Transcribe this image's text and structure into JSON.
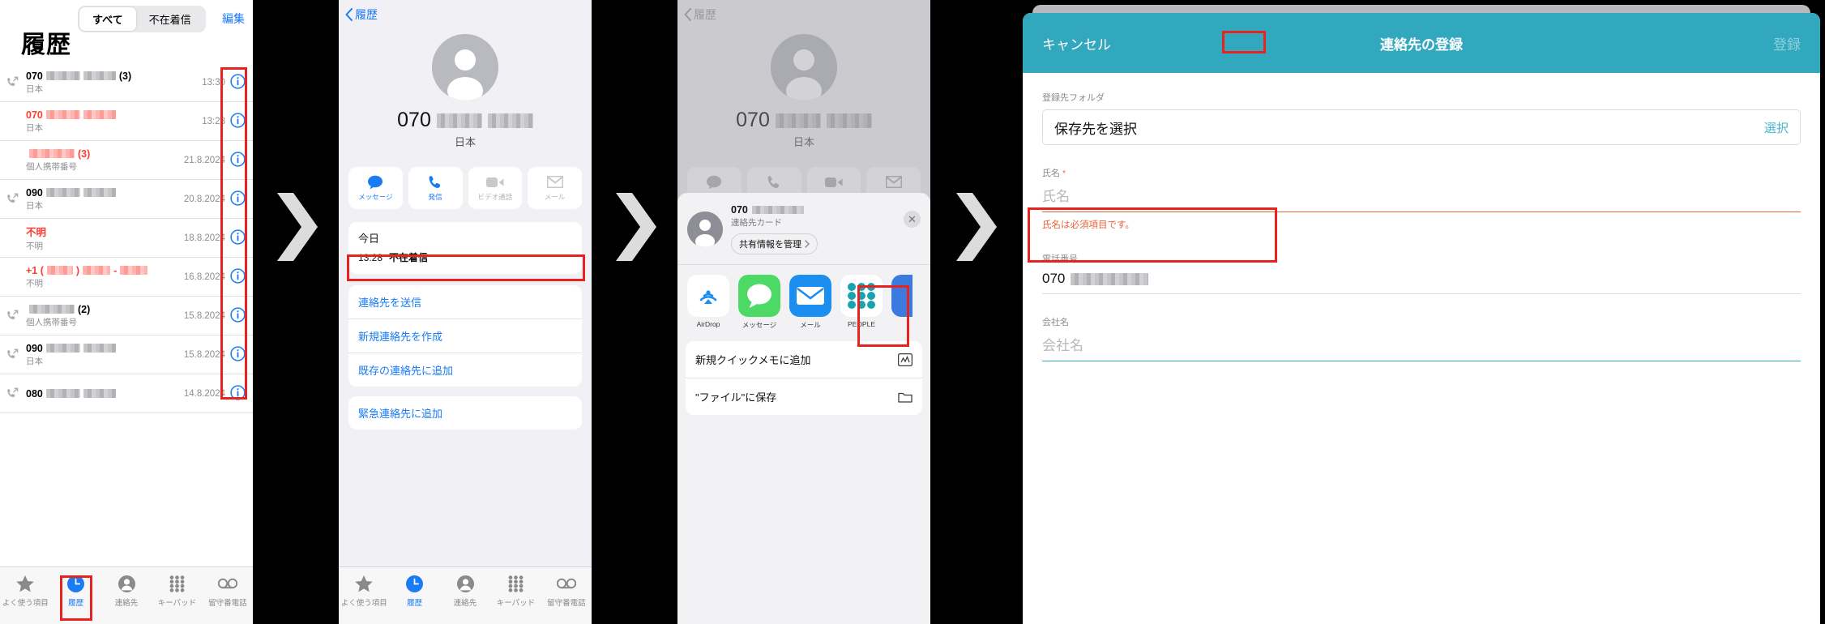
{
  "panel1": {
    "segments": [
      {
        "label": "すべて",
        "active": true
      },
      {
        "label": "不在着信",
        "active": false
      }
    ],
    "edit_label": "編集",
    "title": "履歴",
    "calls": [
      {
        "prefix": "070",
        "redact": "wide",
        "count": "(3)",
        "sub": "日本",
        "time": "13:30",
        "missed": false,
        "outgoing": true
      },
      {
        "prefix": "070",
        "redact": "wide",
        "count": "",
        "sub": "日本",
        "time": "13:28",
        "missed": true,
        "outgoing": false
      },
      {
        "prefix": "",
        "redact": "mid",
        "count": "(3)",
        "sub": "個人携帯番号",
        "time": "21.8.2024",
        "missed": true,
        "outgoing": false
      },
      {
        "prefix": "090",
        "redact": "wide",
        "count": "",
        "sub": "日本",
        "time": "20.8.2024",
        "missed": false,
        "outgoing": true
      },
      {
        "prefix": "不明",
        "redact": "none",
        "count": "",
        "sub": "不明",
        "time": "18.8.2024",
        "missed": true,
        "outgoing": false
      },
      {
        "prefix": "+1 (",
        "redact": "us",
        "count": "",
        "sub": "不明",
        "time": "16.8.2024",
        "missed": true,
        "outgoing": false
      },
      {
        "prefix": "",
        "redact": "mid",
        "count": "(2)",
        "sub": "個人携帯番号",
        "time": "15.8.2024",
        "missed": false,
        "outgoing": true
      },
      {
        "prefix": "090",
        "redact": "wide",
        "count": "",
        "sub": "日本",
        "time": "15.8.2024",
        "missed": false,
        "outgoing": true
      },
      {
        "prefix": "080",
        "redact": "wide",
        "count": "",
        "sub": "",
        "time": "14.8.2024",
        "missed": false,
        "outgoing": true
      }
    ],
    "tabs": [
      {
        "label": "よく使う項目",
        "icon": "star-icon",
        "active": false
      },
      {
        "label": "履歴",
        "icon": "clock-icon",
        "active": true
      },
      {
        "label": "連絡先",
        "icon": "person-icon",
        "active": false
      },
      {
        "label": "キーパッド",
        "icon": "keypad-icon",
        "active": false
      },
      {
        "label": "留守番電話",
        "icon": "voicemail-icon",
        "active": false
      }
    ]
  },
  "panel2": {
    "back_label": "履歴",
    "number_prefix": "070",
    "country": "日本",
    "actions": [
      {
        "label": "メッセージ",
        "icon": "message-icon",
        "enabled": true
      },
      {
        "label": "発信",
        "icon": "phone-icon",
        "enabled": true
      },
      {
        "label": "ビデオ通話",
        "icon": "video-icon",
        "enabled": false
      },
      {
        "label": "メール",
        "icon": "mail-icon",
        "enabled": false
      }
    ],
    "recent": {
      "day": "今日",
      "time": "13:28",
      "type": "不在着信"
    },
    "options_group1": [
      {
        "label": "連絡先を送信",
        "highlighted": true
      },
      {
        "label": "新規連絡先を作成",
        "highlighted": false
      },
      {
        "label": "既存の連絡先に追加",
        "highlighted": false
      }
    ],
    "options_group2": [
      {
        "label": "緊急連絡先に追加",
        "highlighted": false
      }
    ],
    "tabs": [
      {
        "label": "よく使う項目",
        "icon": "star-icon",
        "active": false
      },
      {
        "label": "履歴",
        "icon": "clock-icon",
        "active": true
      },
      {
        "label": "連絡先",
        "icon": "person-icon",
        "active": false
      },
      {
        "label": "キーパッド",
        "icon": "keypad-icon",
        "active": false
      },
      {
        "label": "留守番電話",
        "icon": "voicemail-icon",
        "active": false
      }
    ]
  },
  "panel3": {
    "back_label": "履歴",
    "number_prefix": "070",
    "country": "日本",
    "actions": [
      {
        "label": "メッセージ",
        "icon": "message-icon",
        "enabled": false
      },
      {
        "label": "発信",
        "icon": "phone-icon",
        "enabled": false
      },
      {
        "label": "ビデオ通話",
        "icon": "video-icon",
        "enabled": false
      },
      {
        "label": "メール",
        "icon": "mail-icon",
        "enabled": false
      }
    ],
    "sheet": {
      "title_prefix": "070",
      "subtitle": "連絡先カード",
      "manage_label": "共有情報を管理",
      "close_icon": "close-icon",
      "apps": [
        {
          "name": "AirDrop",
          "icon": "airdrop-icon"
        },
        {
          "name": "メッセージ",
          "icon": "messages-app-icon"
        },
        {
          "name": "メール",
          "icon": "mail-app-icon"
        },
        {
          "name": "PEOPLE",
          "icon": "people-app-icon",
          "highlighted": true
        }
      ],
      "items": [
        {
          "label": "新規クイックメモに追加",
          "icon": "note-icon"
        },
        {
          "label": "\"ファイル\"に保存",
          "icon": "folder-icon"
        }
      ]
    }
  },
  "panel4": {
    "cancel_label": "キャンセル",
    "title": "連絡先の登録",
    "submit_label": "登録",
    "folder": {
      "label": "登録先フォルダ",
      "value": "保存先を選択",
      "action": "選択"
    },
    "name": {
      "label": "氏名",
      "required_mark": "*",
      "placeholder": "氏名",
      "error": "氏名は必須項目です。"
    },
    "phone": {
      "label": "電話番号",
      "value_prefix": "070"
    },
    "company": {
      "label": "会社名",
      "placeholder": "会社名"
    }
  },
  "colors": {
    "ios_blue": "#1a7cf5",
    "missed_red": "#ff3b30",
    "highlight_red": "#e8231f",
    "teal": "#31a8bd",
    "error_orange": "#e8623c"
  }
}
